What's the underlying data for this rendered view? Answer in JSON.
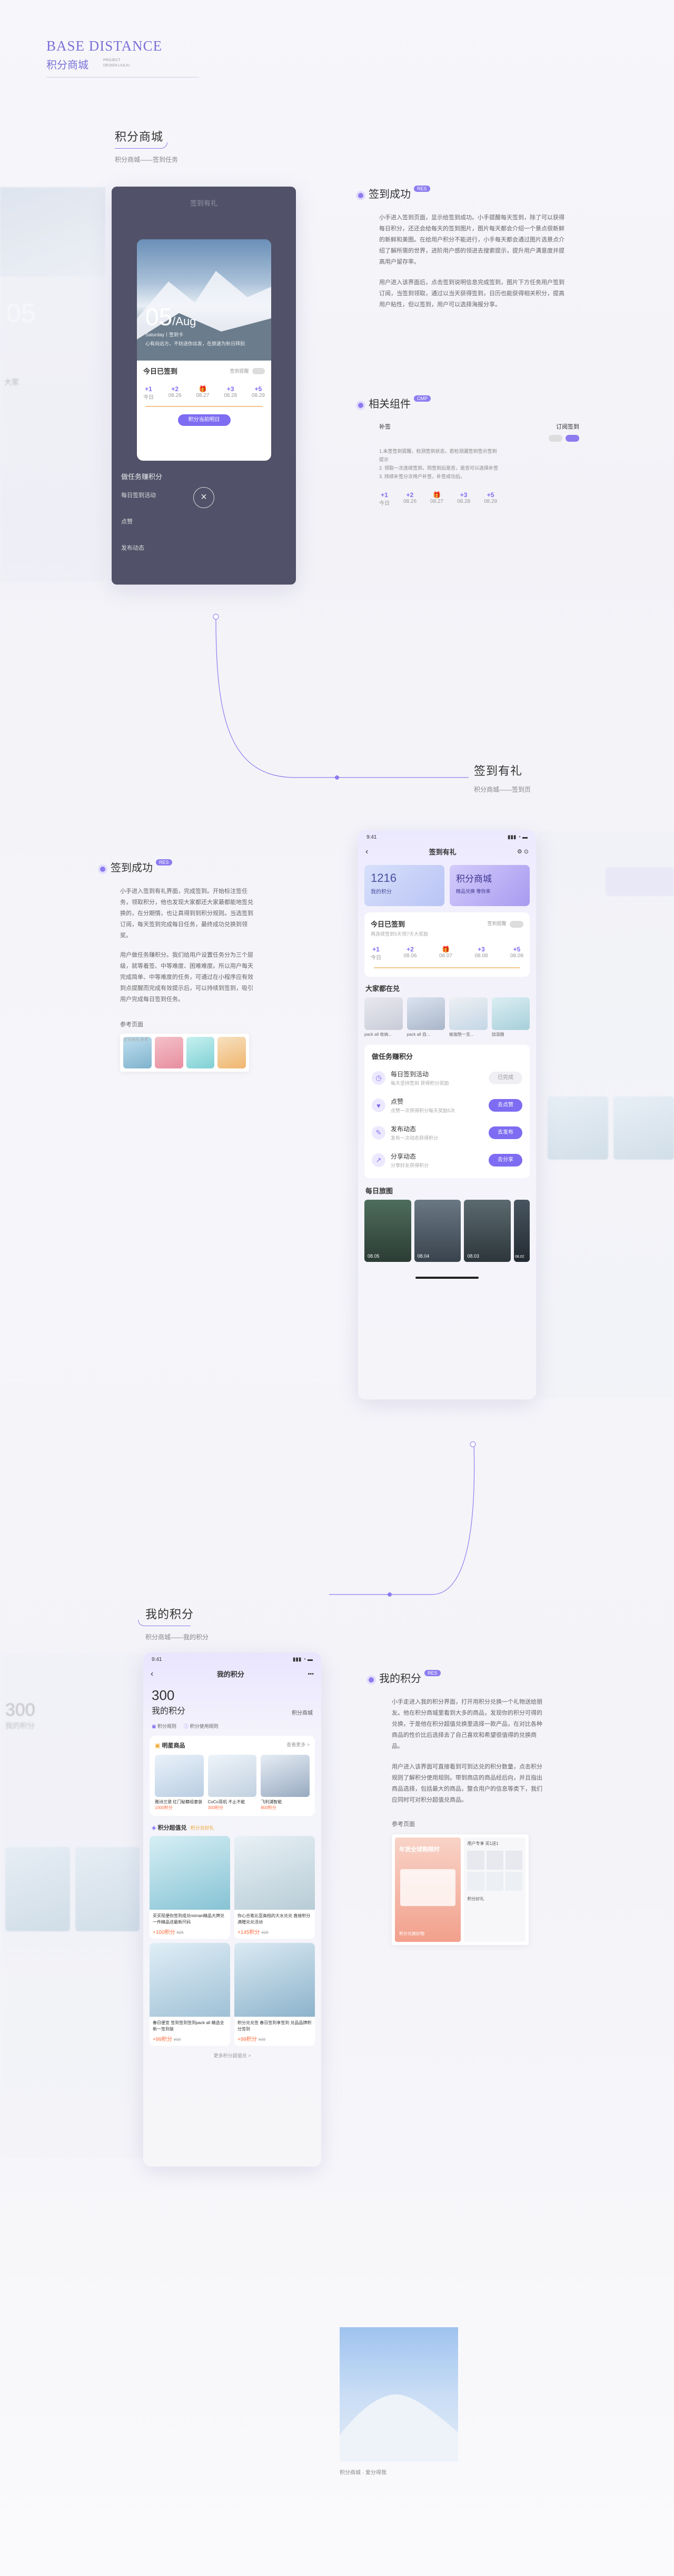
{
  "brand": {
    "title": "BASE DISTANCE",
    "subtitle": "积分商城",
    "tag1": "PROJECT",
    "tag2": "DESIGN LIULIU"
  },
  "s1": {
    "title": "积分商城",
    "sub": "积分商城——签到任务",
    "phone_title": "签到有礼",
    "card": {
      "day": "05",
      "month": "/Aug",
      "meta": "Saturday丨签到卡",
      "quote": "心有向远方，不妨送你出发，在旅途为秋日拜别"
    },
    "signed_label": "今日已签到",
    "remind": "签到提醒",
    "days": [
      {
        "v": "+1",
        "d": "今日"
      },
      {
        "v": "+2",
        "d": "08.26"
      },
      {
        "v": "🎁",
        "d": "08.27"
      },
      {
        "v": "+3",
        "d": "08.28"
      },
      {
        "v": "+5",
        "d": "08.29"
      }
    ],
    "btn": "积分当前明日",
    "tasks_title": "做任务赚积分",
    "task1": "每日签到活动",
    "task2": "点赞",
    "task3": "发布动态",
    "ghost_num": "05",
    "ghost_side": "大家"
  },
  "s2": {
    "title": "签到成功",
    "badge": "RES",
    "p1": "小手进入签到页面，显示给签到成功。小手提醒每天签到，除了可以获得每日积分，还还会给每天的签到图片，图片每天都会介绍一个景点很新鲜的新鲜和美图。在给用户积分不能进行，小手每天都会通过图片选景点介绍了解所需的世界，进阶用户感的领进去搜索提示，提升用户满意度并提高用户留存率。",
    "p2": "用户进入该界面后，点击签到说明信息完成签到，图片下方任务用户签到订阅，当签到领取，通过以当天获得签到，日历也能获得相关积分，提高用户粘性，但以签到，用户可以选择海报分享。"
  },
  "s3": {
    "title": "相关组件",
    "badge": "CMP",
    "left_label": "补签",
    "right_label": "订阅签到",
    "notes": [
      "1.未签签到提醒，检测签到状态，若检测漏签到签示签到提示",
      "2. 领取一次连续签到，则签到后是否，是否可以选择补签",
      "3. 持续补签分次用户补签，补签成功后。"
    ],
    "days": [
      {
        "v": "+1",
        "d": "今日"
      },
      {
        "v": "+2",
        "d": "08.26"
      },
      {
        "v": "🎁",
        "d": "08.27"
      },
      {
        "v": "+3",
        "d": "08.28"
      },
      {
        "v": "+5",
        "d": "08.29"
      }
    ]
  },
  "s4": {
    "title": "签到有礼",
    "sub": "积分商城——签到页",
    "phone": {
      "time": "9:41",
      "nav_title": "签到有礼",
      "points": "1216",
      "points_label": "我的积分",
      "mall": "积分商城",
      "mall_sub": "精品兑换 等你来",
      "signed": "今日已签到",
      "signed_sub": "再连续签到5天领7天大奖励",
      "remind": "签到提醒",
      "days": [
        {
          "v": "+1",
          "d": "今日"
        },
        {
          "v": "+2",
          "d": "08.06"
        },
        {
          "v": "🎁",
          "d": "08.07"
        },
        {
          "v": "+3",
          "d": "08.08"
        },
        {
          "v": "+5",
          "d": "08.09"
        }
      ],
      "everyone": "大家都在兑",
      "goods": [
        "pack all 收纳...",
        "pack all 自...",
        "瑜伽垫一支...",
        "加湿器"
      ],
      "tasks_title": "做任务赚积分",
      "tasks": [
        {
          "t": "每日签到活动",
          "s": "每天坚持签到 获得积分奖励",
          "b": "已完成",
          "done": true
        },
        {
          "t": "点赞",
          "s": "点赞一次获得积分每天奖励5次",
          "b": "去点赞",
          "done": false
        },
        {
          "t": "发布动态",
          "s": "发布一次动态获得积分",
          "b": "去发布",
          "done": false
        },
        {
          "t": "分享动态",
          "s": "分享好友获得积分",
          "b": "去分享",
          "done": false
        }
      ],
      "gallery": "每日旅图",
      "gallery_dates": [
        "08.05",
        "08.04",
        "08.03",
        "08.02"
      ]
    }
  },
  "s5": {
    "title": "签到成功",
    "badge": "RES",
    "p1": "小手进入签到有礼界面，完成签到。开始标注签任务，领取积分，他也发现大家都还大家最都能地签兑换的，在分期情，也让真得到到积分规则。当选签到订阅，每天签到完成每日任务，最终成功兑换到领奖。",
    "p2": "用户做任务赚积分。我们给用户设置任务分为三个层级，就等着签、中等难度、困难难度。所以用户每天完成简单、中等难度的任务，可通过在小程序应有效到点提醒而完成有效提示后，可以持续到签到，吸引用户完成每日签到任务。",
    "ref_label": "参考页面",
    "ref_sub": "签到有礼参考"
  },
  "s6": {
    "title": "我的积分",
    "sub": "积分商城——我的积分",
    "ghost_num": "300",
    "ghost_label": "我的积分",
    "phone": {
      "time": "9:41",
      "nav_title": "我的积分",
      "more": "•••",
      "points": "300",
      "points_label": "我的积分",
      "mall": "积分商城",
      "rule1": "积分规则",
      "rule2": "积分使用规则",
      "star_title": "明星商品",
      "see_all": "查看更多 >",
      "star_items": [
        {
          "n": "雅诗兰黛 红门秘籍组套装",
          "p": "1000积分"
        },
        {
          "n": "CoCo耳机 不止不能",
          "p": "300积分"
        },
        {
          "n": "飞利浦智能",
          "p": "800积分"
        }
      ],
      "exchange_title": "积分超值兑",
      "exchange_tag": "积分兑好礼",
      "cards": [
        {
          "n": "买买现便你签到成兑miman精品大牌兑一件精品送最新尺码",
          "p": "+100积分",
          "o": "¥25"
        },
        {
          "n": "你心合笔比亚高档的大水兑兑 直接积分满赠兑兑活动",
          "p": "+145积分",
          "o": "¥29"
        },
        {
          "n": "春日便宜 签到签到签到pack all 精选全新一签到装",
          "p": "+99积分",
          "o": "¥19"
        },
        {
          "n": "积分兑兑签 春日签到享签到 兑品品牌积分签到",
          "p": "+99积分",
          "o": "¥19"
        }
      ],
      "more_link": "更多积分超值兑 >"
    }
  },
  "s7": {
    "title": "我的积分",
    "badge": "RES",
    "p1": "小手走进入我的积分界面，打开用积分兑换一个礼物送给朋友。他在积分商城里看到大多的商品，发现你的积分可得的兑换，于是他在积分超值兑换里选择一款产品，在对比各种商品的性价比后选择去了自己喜欢和希望很值得的兑换商品。",
    "p2": "用户进入该界面可直接看到可到达兑的积分数量，点击积分规则了解积分使用规则。带到商店的商品经后向，并且指出商品选择，包括最大的商品，整合用户的信息等类下，我们应同时可对积分超值兑商品。",
    "ref_label": "参考页面",
    "ref_header": "用户专享 买1送1",
    "ref_sub": "积分好礼",
    "ref_banner": "年货全球购限时",
    "ref_small": "积分兑换好物"
  },
  "footer": {
    "caption": "积分商城 · 爱分得我"
  }
}
